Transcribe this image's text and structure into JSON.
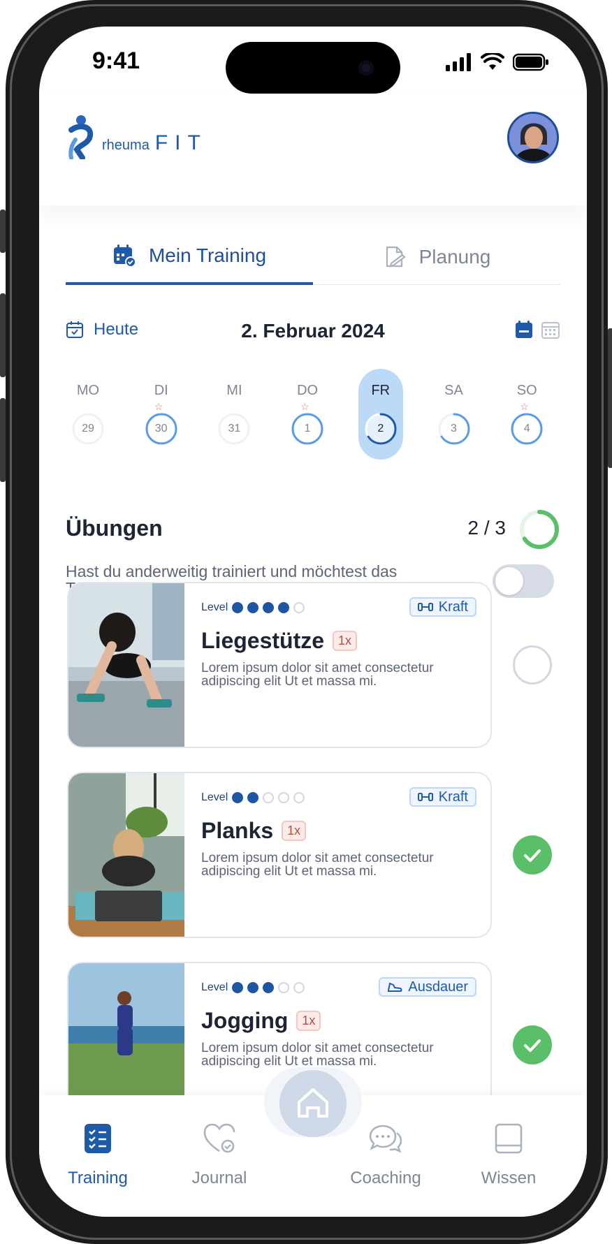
{
  "status": {
    "time": "9:41"
  },
  "brand": {
    "small": "rheuma",
    "big": "FIT"
  },
  "tabs": [
    {
      "label": "Mein Training",
      "active": true
    },
    {
      "label": "Planung",
      "active": false
    }
  ],
  "datebar": {
    "today_label": "Heute",
    "date_title": "2. Februar 2024"
  },
  "week": [
    {
      "label": "MO",
      "num": "29",
      "star": false,
      "progress": 0
    },
    {
      "label": "DI",
      "num": "30",
      "star": true,
      "progress": 1
    },
    {
      "label": "MI",
      "num": "31",
      "star": false,
      "progress": 0
    },
    {
      "label": "DO",
      "num": "1",
      "star": true,
      "progress": 1
    },
    {
      "label": "FR",
      "num": "2",
      "star": false,
      "progress": 0.66,
      "selected": true
    },
    {
      "label": "SA",
      "num": "3",
      "star": false,
      "progress": 0.66
    },
    {
      "label": "SO",
      "num": "4",
      "star": true,
      "progress": 1
    }
  ],
  "exercises_section": {
    "title": "Übungen",
    "count": "2 / 3",
    "progress": 0.66,
    "compensate_text": "Hast du anderweitig trainiert und möchtest das Training kompensieren?",
    "compensate_on": false
  },
  "exercises": [
    {
      "level_label": "Level",
      "level": 4,
      "category": "Kraft",
      "category_icon": "dumbbell-icon",
      "name": "Liegestütze",
      "badge": "1x",
      "desc": "Lorem ipsum dolor sit amet consectetur adipiscing elit Ut et massa mi.",
      "done": false
    },
    {
      "level_label": "Level",
      "level": 2,
      "category": "Kraft",
      "category_icon": "dumbbell-icon",
      "name": "Planks",
      "badge": "1x",
      "desc": "Lorem ipsum dolor sit amet consectetur adipiscing elit Ut et massa mi.",
      "done": true
    },
    {
      "level_label": "Level",
      "level": 3,
      "category": "Ausdauer",
      "category_icon": "shoe-icon",
      "name": "Jogging",
      "badge": "1x",
      "desc": "Lorem ipsum dolor sit amet consectetur adipiscing elit Ut et massa mi.",
      "done": true
    }
  ],
  "nav": [
    {
      "label": "Training",
      "icon": "checklist-icon",
      "active": true
    },
    {
      "label": "Journal",
      "icon": "heart-check-icon",
      "active": false
    },
    {
      "label": "Coaching",
      "icon": "chat-icon",
      "active": false
    },
    {
      "label": "Wissen",
      "icon": "book-icon",
      "active": false
    }
  ],
  "colors": {
    "accent": "#1f5aa8",
    "success": "#5bbf6a",
    "selected_day": "#bcdaf8",
    "ring": "#5a9ce8"
  }
}
